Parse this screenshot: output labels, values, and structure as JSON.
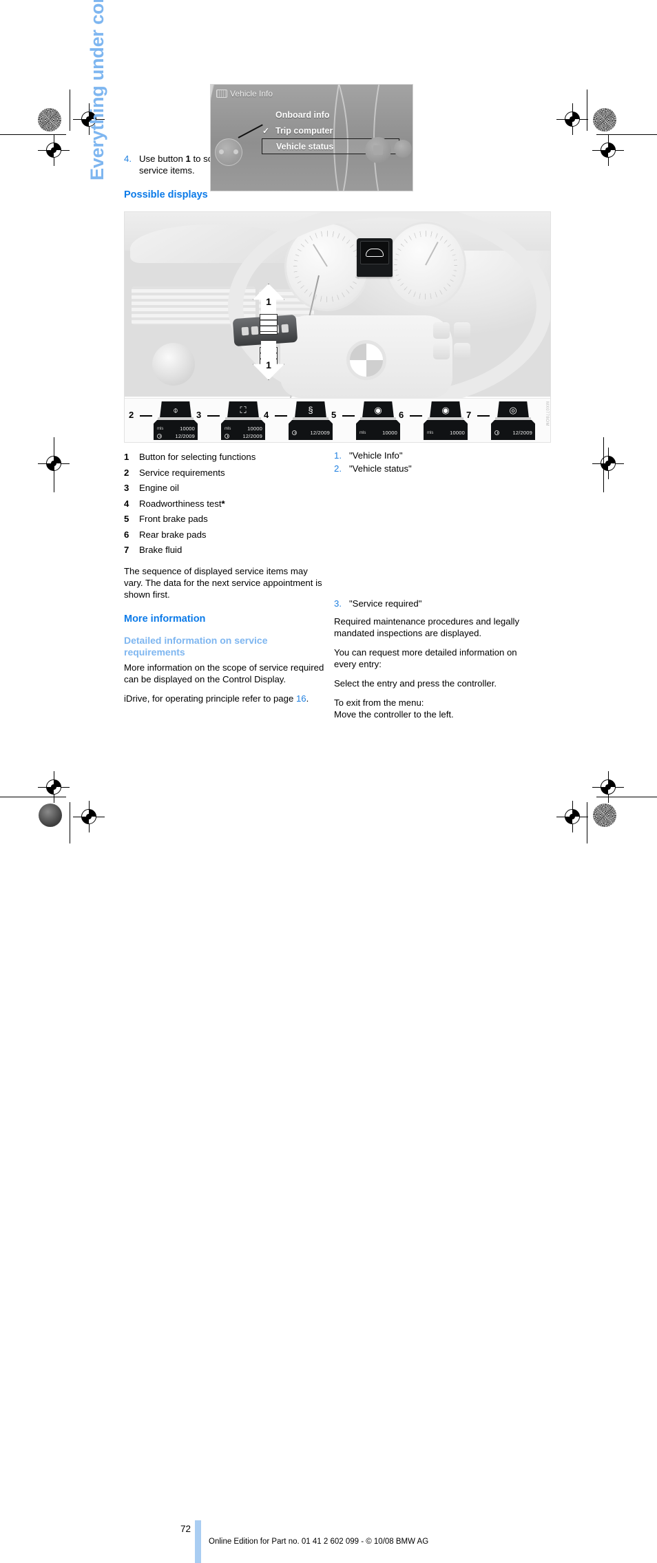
{
  "page": {
    "side_title": "Everything under control",
    "number": "72",
    "footer": "Online Edition for Part no. 01 41 2 602 099 - © 10/08 BMW AG"
  },
  "left_column": {
    "step4": {
      "num": "4.",
      "text_before": "Use button ",
      "bold": "1",
      "text_after": " to scroll through the individual service items."
    },
    "heading_possible_displays": "Possible displays",
    "legend": [
      {
        "num": "1",
        "label": "Button for selecting functions"
      },
      {
        "num": "2",
        "label": "Service requirements"
      },
      {
        "num": "3",
        "label": "Engine oil"
      },
      {
        "num": "4",
        "label": "Roadworthiness test",
        "star": "*"
      },
      {
        "num": "5",
        "label": "Front brake pads"
      },
      {
        "num": "6",
        "label": "Rear brake pads"
      },
      {
        "num": "7",
        "label": "Brake fluid"
      }
    ],
    "note": "The sequence of displayed service items may vary. The data for the next service appointment is shown first.",
    "heading_more_information": "More information",
    "heading_detailed": "Detailed information on service requirements",
    "para_detailed": "More information on the scope of service required can be displayed on the Control Display.",
    "para_idrive_before": "iDrive, for operating principle refer to page ",
    "para_idrive_link": "16",
    "para_idrive_after": "."
  },
  "right_column": {
    "steps_top": [
      {
        "num": "1.",
        "text": "\"Vehicle Info\""
      },
      {
        "num": "2.",
        "text": "\"Vehicle status\""
      }
    ],
    "step3": {
      "num": "3.",
      "text": "\"Service required\""
    },
    "paragraphs": [
      "Required maintenance procedures and legally mandated inspections are displayed.",
      "You can request more detailed information on every entry:",
      "Select the entry and press the controller.",
      "To exit from the menu:\nMove the controller to the left."
    ]
  },
  "figure_main": {
    "callout_arrow_up": "1",
    "callout_arrow_down": "1",
    "image_code": "MX0778OM",
    "symbols": [
      {
        "num": "2",
        "glyph": "car-service-icon",
        "distance_unit": "mls",
        "distance": "10000",
        "date": "12/2009"
      },
      {
        "num": "3",
        "glyph": "oil-can-icon",
        "distance_unit": "mls",
        "distance": "10000",
        "date": "12/2009"
      },
      {
        "num": "4",
        "glyph": "roadworthiness-icon",
        "distance_unit": "",
        "distance": "",
        "date": "12/2009"
      },
      {
        "num": "5",
        "glyph": "front-brake-pads-icon",
        "distance_unit": "mls",
        "distance": "10000",
        "date": ""
      },
      {
        "num": "6",
        "glyph": "rear-brake-pads-icon",
        "distance_unit": "mls",
        "distance": "10000",
        "date": ""
      },
      {
        "num": "7",
        "glyph": "brake-fluid-icon",
        "distance_unit": "",
        "distance": "",
        "date": "12/2009"
      }
    ]
  },
  "figure_idrive": {
    "title": "Vehicle Info",
    "items": [
      {
        "label": "Onboard info",
        "checked": false,
        "selected": false
      },
      {
        "label": "Trip computer",
        "checked": true,
        "selected": false
      },
      {
        "label": "Vehicle status",
        "checked": false,
        "selected": true
      }
    ],
    "check_glyph": "✓"
  },
  "colors": {
    "heading_blue": "#0B7AE8",
    "subheading_light_blue": "#7EB6F0",
    "step_number_blue": "#1E7FE0",
    "footer_bar": "#A9CDF2"
  }
}
